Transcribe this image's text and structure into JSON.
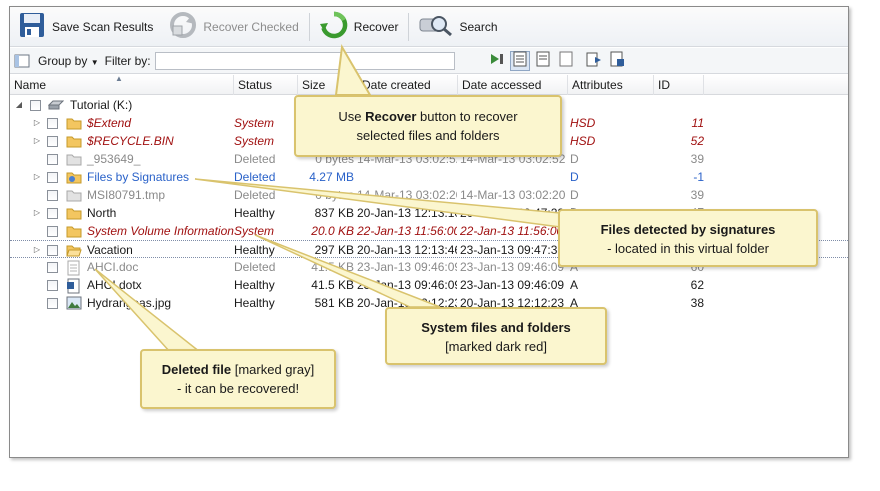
{
  "toolbar": {
    "save_label": "Save Scan Results",
    "recover_checked_label": "Recover Checked",
    "recover_label": "Recover",
    "search_label": "Search"
  },
  "filterbar": {
    "group_by_label": "Group by",
    "filter_by_label": "Filter by:",
    "filter_value": ""
  },
  "columns": {
    "name": "Name",
    "status": "Status",
    "size": "Size",
    "created": "Date created",
    "accessed": "Date accessed",
    "attributes": "Attributes",
    "id": "ID"
  },
  "root": {
    "label": "Tutorial (K:)"
  },
  "rows": [
    {
      "name": "$Extend",
      "status": "System",
      "size": "",
      "created": "",
      "accessed": "",
      "attr": "HSD",
      "id": "11",
      "kind": "system",
      "icon": "folder",
      "expandable": true
    },
    {
      "name": "$RECYCLE.BIN",
      "status": "System",
      "size": "",
      "created": "",
      "accessed": "",
      "attr": "HSD",
      "id": "52",
      "kind": "system",
      "icon": "folder",
      "expandable": true
    },
    {
      "name": "_953649_",
      "status": "Deleted",
      "size": "0 bytes",
      "created": "14-Mar-13 03:02:52",
      "accessed": "14-Mar-13 03:02:52",
      "attr": "D",
      "id": "39",
      "kind": "deleted",
      "icon": "folder-gray",
      "expandable": false
    },
    {
      "name": "Files by Signatures",
      "status": "Deleted",
      "size": "4.27 MB",
      "created": "",
      "accessed": "",
      "attr": "D",
      "id": "-1",
      "kind": "virtual",
      "icon": "folder-signature",
      "expandable": true
    },
    {
      "name": "MSI80791.tmp",
      "status": "Deleted",
      "size": "0 bytes",
      "created": "14-Mar-13 03:02:20",
      "accessed": "14-Mar-13 03:02:20",
      "attr": "D",
      "id": "39",
      "kind": "deleted",
      "icon": "folder-gray",
      "expandable": false
    },
    {
      "name": "North",
      "status": "Healthy",
      "size": "837 KB",
      "created": "20-Jan-13 12:13:10",
      "accessed": "20-Jan-13 09:47:22",
      "attr": "D",
      "id": "47",
      "kind": "healthy",
      "icon": "folder",
      "expandable": true
    },
    {
      "name": "System Volume Information",
      "status": "System",
      "size": "20.0 KB",
      "created": "22-Jan-13 11:56:00",
      "accessed": "22-Jan-13 11:56:00",
      "attr": "HSD",
      "id": "",
      "kind": "system",
      "icon": "folder",
      "expandable": false
    },
    {
      "name": "Vacation",
      "status": "Healthy",
      "size": "297 KB",
      "created": "20-Jan-13 12:13:46",
      "accessed": "23-Jan-13 09:47:33",
      "attr": "D",
      "id": "",
      "kind": "healthy",
      "icon": "folder-open",
      "expandable": true,
      "selected": true
    },
    {
      "name": "AHCI.doc",
      "status": "Deleted",
      "size": "41.5 KB",
      "created": "23-Jan-13 09:46:09",
      "accessed": "23-Jan-13 09:46:09",
      "attr": "A",
      "id": "60",
      "kind": "deleted",
      "icon": "doc-gray",
      "expandable": false
    },
    {
      "name": "AHCI.dotx",
      "status": "Healthy",
      "size": "41.5 KB",
      "created": "23-Jan-13 09:46:09",
      "accessed": "23-Jan-13 09:46:09",
      "attr": "A",
      "id": "62",
      "kind": "healthy",
      "icon": "doc",
      "expandable": false
    },
    {
      "name": "Hydrangeas.jpg",
      "status": "Healthy",
      "size": "581 KB",
      "created": "20-Jan-13 12:12:23",
      "accessed": "20-Jan-13 12:12:23",
      "attr": "A",
      "id": "38",
      "kind": "healthy",
      "icon": "image",
      "expandable": false
    }
  ],
  "callouts": {
    "recover_bold": "Recover",
    "recover_pre": "Use ",
    "recover_post": " button to recover",
    "recover_line2": "selected files and folders",
    "signatures_bold": "Files detected by signatures",
    "signatures_line2": "- located in this virtual folder",
    "system_bold": "System files and folders",
    "system_line2": "[marked dark red]",
    "deleted_bold": "Deleted file",
    "deleted_post": " [marked gray]",
    "deleted_line2": "- it can be recovered!"
  },
  "colors": {
    "system": "#a01010",
    "deleted": "#8a8a8a",
    "virtual": "#2a62c9",
    "callout_bg": "#fbf6cf",
    "callout_border": "#d9c36d"
  }
}
